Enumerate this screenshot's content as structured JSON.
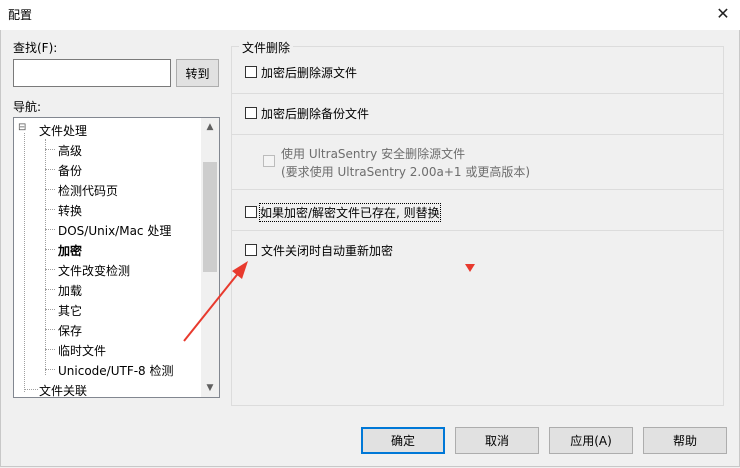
{
  "window": {
    "title": "配置",
    "close_glyph": "✕"
  },
  "search": {
    "label": "查找(F):",
    "value": "",
    "go_button": "转到"
  },
  "nav": {
    "label": "导航:",
    "items": [
      {
        "label": "文件处理",
        "bold": false,
        "expander": "⊟"
      },
      {
        "label": "高级"
      },
      {
        "label": "备份"
      },
      {
        "label": "检测代码页"
      },
      {
        "label": "转换"
      },
      {
        "label": "DOS/Unix/Mac 处理"
      },
      {
        "label": "加密",
        "bold": true
      },
      {
        "label": "文件改变检测"
      },
      {
        "label": "加载"
      },
      {
        "label": "其它"
      },
      {
        "label": "保存"
      },
      {
        "label": "临时文件"
      },
      {
        "label": "Unicode/UTF-8 检测"
      },
      {
        "label": "文件关联"
      }
    ]
  },
  "panel": {
    "group_label": "文件删除",
    "options": [
      {
        "label": "加密后删除源文件",
        "checked": false
      },
      {
        "label": "加密后删除备份文件",
        "checked": false
      },
      {
        "label": "使用 UltraSentry 安全删除源文件",
        "sub": "(要求使用 UltraSentry 2.00a+1 或更高版本)",
        "checked": false,
        "disabled": true
      },
      {
        "label": "如果加密/解密文件已存在, 则替换",
        "checked": false
      },
      {
        "label": "文件关闭时自动重新加密",
        "checked": false
      }
    ]
  },
  "buttons": {
    "ok": "确定",
    "cancel": "取消",
    "apply": "应用(A)",
    "help": "帮助"
  },
  "annotation": {
    "color": "#e83a2e"
  }
}
